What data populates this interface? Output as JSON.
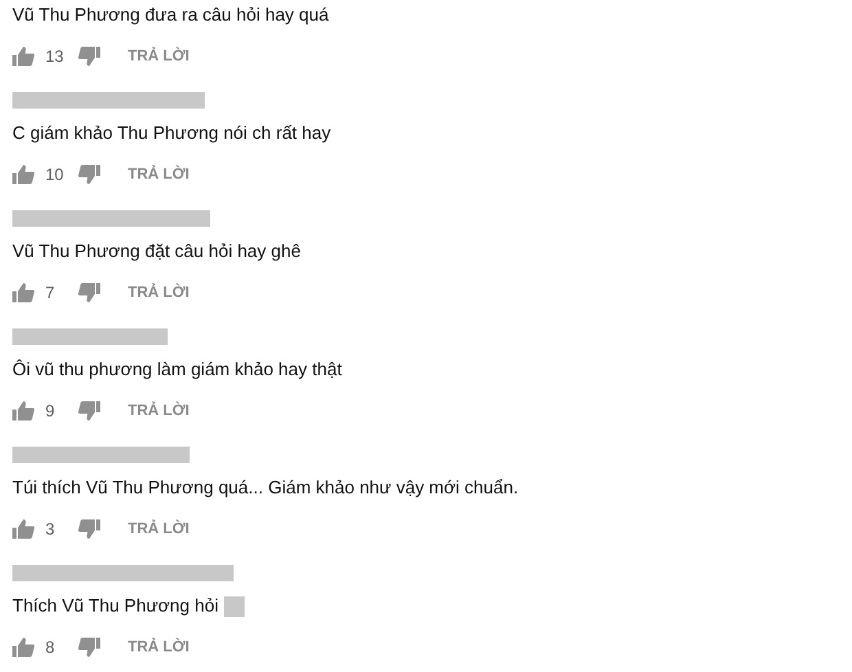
{
  "comments": [
    {
      "redacted_name": false,
      "text": "Vũ Thu Phương đưa ra câu hỏi hay quá",
      "redacted_tail": false,
      "likes": "13",
      "reply": "TRẢ LỜI"
    },
    {
      "redacted_name": true,
      "text": "C giám khảo Thu Phương nói ch rất hay",
      "redacted_tail": false,
      "likes": "10",
      "reply": "TRẢ LỜI"
    },
    {
      "redacted_name": true,
      "text": "Vũ Thu Phương đặt câu hỏi hay ghê",
      "redacted_tail": false,
      "likes": "7",
      "reply": "TRẢ LỜI"
    },
    {
      "redacted_name": true,
      "text": "Ôi vũ thu phương làm giám khảo hay thật",
      "redacted_tail": false,
      "likes": "9",
      "reply": "TRẢ LỜI"
    },
    {
      "redacted_name": true,
      "text": "Túi thích Vũ Thu Phương quá... Giám khảo như vậy mới chuẩn.",
      "redacted_tail": false,
      "likes": "3",
      "reply": "TRẢ LỜI"
    },
    {
      "redacted_name": true,
      "text": "Thích Vũ Thu Phương hỏi",
      "redacted_tail": true,
      "likes": "8",
      "reply": "TRẢ LỜI"
    }
  ]
}
